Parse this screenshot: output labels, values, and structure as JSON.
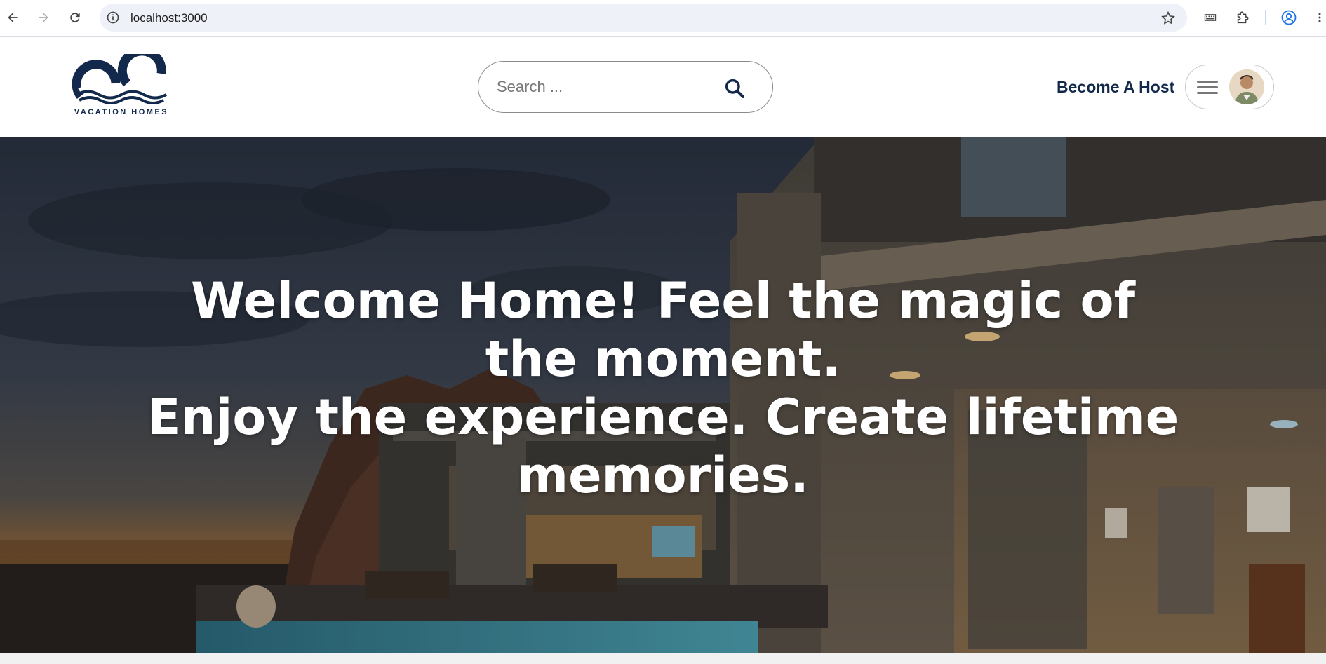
{
  "browser": {
    "url": "localhost:3000",
    "icons": [
      "back-arrow-icon",
      "forward-arrow-icon",
      "reload-icon",
      "site-info-icon",
      "bookmark-star-icon",
      "extension-qr-icon",
      "extensions-puzzle-icon",
      "profile-icon",
      "more-vert-icon"
    ]
  },
  "header": {
    "logo_text": "VACATION HOMES",
    "search": {
      "placeholder": "Search ..."
    },
    "become_host_label": "Become A Host",
    "brand_color": "#13294b"
  },
  "hero": {
    "title_line_1": "Welcome Home! Feel the magic of the moment.",
    "title_line_2": "Enjoy the experience. Create lifetime memories."
  }
}
